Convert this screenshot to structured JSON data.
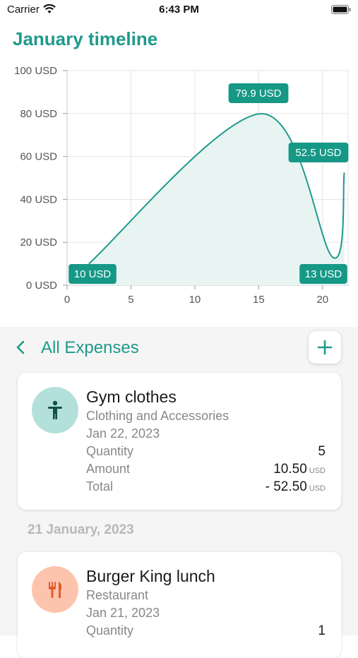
{
  "status": {
    "carrier": "Carrier",
    "time": "6:43 PM"
  },
  "title": "January timeline",
  "chart_data": {
    "type": "area",
    "y_ticks": [
      "0 USD",
      "20 USD",
      "40 USD",
      "60 USD",
      "80 USD",
      "100 USD"
    ],
    "x_ticks": [
      "0",
      "5",
      "10",
      "15",
      "20"
    ],
    "ylim": [
      0,
      100
    ],
    "xlim": [
      0,
      22
    ],
    "grid": true,
    "points": [
      {
        "x": 1.7,
        "y": 10
      },
      {
        "x": 15.2,
        "y": 79.9
      },
      {
        "x": 20.8,
        "y": 13
      },
      {
        "x": 21.7,
        "y": 52.5
      }
    ],
    "annotations": [
      {
        "label": "10 USD"
      },
      {
        "label": "79.9 USD"
      },
      {
        "label": "52.5 USD"
      },
      {
        "label": "13 USD"
      }
    ],
    "colors": {
      "line": "#1f9a8c",
      "fill": "#e8f4f2",
      "label_bg": "#169886"
    }
  },
  "section": {
    "title": "All Expenses",
    "add_icon": "plus-icon",
    "back_icon": "chevron-left-icon"
  },
  "expenses": [
    {
      "title": "Gym clothes",
      "category": "Clothing and Accessories",
      "date": "Jan 22, 2023",
      "quantity_label": "Quantity",
      "quantity": "5",
      "amount_label": "Amount",
      "amount": "10.50",
      "amount_unit": "USD",
      "total_label": "Total",
      "total": "- 52.50",
      "total_unit": "USD",
      "icon": "person-icon",
      "icon_bg": "#b4e0db"
    },
    {
      "title": "Burger King lunch",
      "category": "Restaurant",
      "date": "Jan 21, 2023",
      "quantity_label": "Quantity",
      "quantity": "1",
      "icon": "fork-knife-icon",
      "icon_bg": "#fdc4ad"
    }
  ],
  "date_header": "21 January, 2023"
}
